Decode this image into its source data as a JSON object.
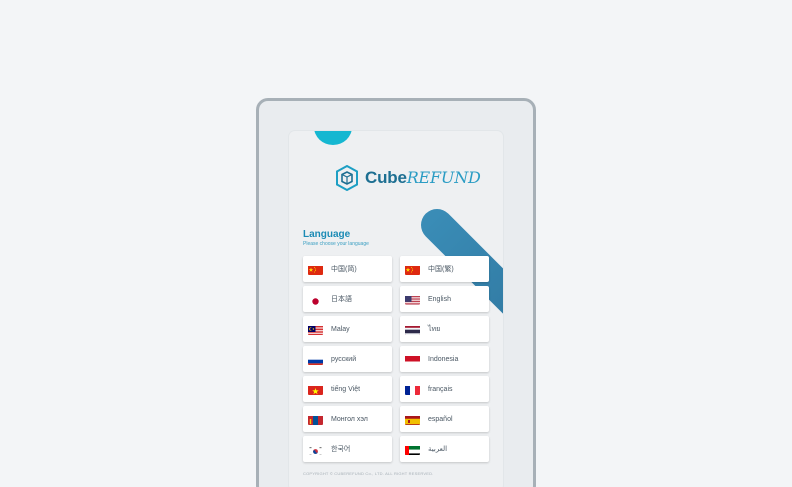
{
  "brand": {
    "name_part1": "Cube",
    "name_part2": "REFUND"
  },
  "language": {
    "title": "Language",
    "subtitle": "Please choose your language",
    "options": [
      {
        "label": "中国(简)",
        "flag": "china-flag"
      },
      {
        "label": "中国(繁)",
        "flag": "china-flag"
      },
      {
        "label": "日本語",
        "flag": "japan-flag"
      },
      {
        "label": "English",
        "flag": "usa-flag"
      },
      {
        "label": "Malay",
        "flag": "malaysia-flag"
      },
      {
        "label": "ไทย",
        "flag": "thailand-flag"
      },
      {
        "label": "русский",
        "flag": "russia-flag"
      },
      {
        "label": "Indonesia",
        "flag": "indonesia-flag"
      },
      {
        "label": "tiếng Việt",
        "flag": "vietnam-flag"
      },
      {
        "label": "français",
        "flag": "france-flag"
      },
      {
        "label": "Монгол хэл",
        "flag": "mongolia-flag"
      },
      {
        "label": "español",
        "flag": "spain-flag"
      },
      {
        "label": "한국어",
        "flag": "korea-flag"
      },
      {
        "label": "العربية",
        "flag": "uae-flag"
      }
    ]
  },
  "footer": {
    "copyright": "COPYRIGHT © CUBEREFUND Co., LTD. ALL RIGHT RESERVED."
  },
  "colors": {
    "accent": "#1b8bb5",
    "teal": "#15b7d1",
    "stripe": "#2c6f97"
  }
}
